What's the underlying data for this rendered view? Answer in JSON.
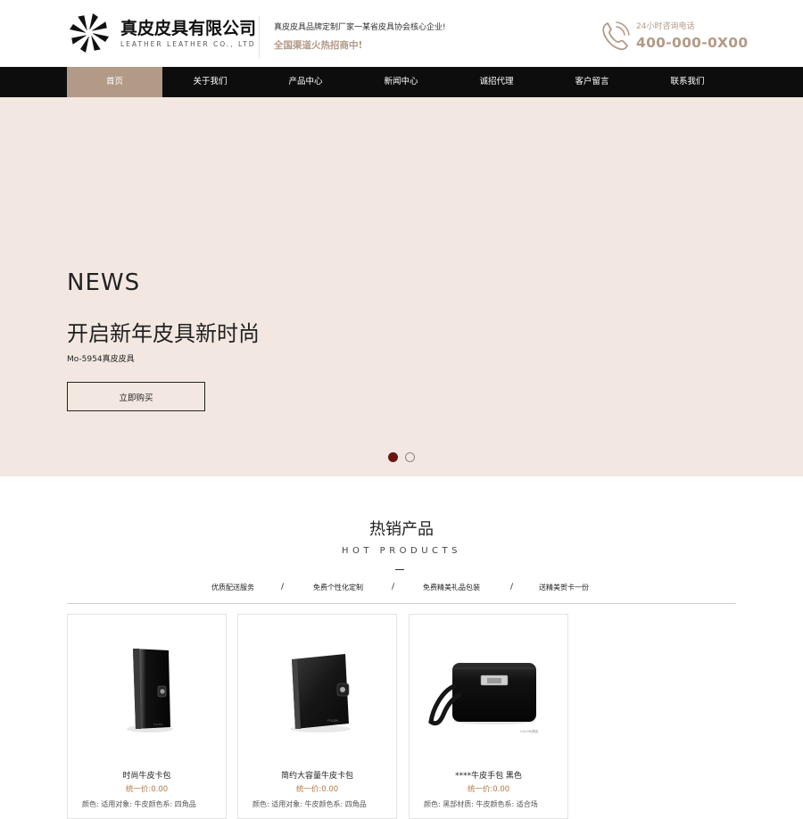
{
  "header": {
    "logo_title": "真皮皮具有限公司",
    "logo_sub": "LEATHER LEATHER CO., LTD",
    "slogan_1": "真皮皮具品牌定制厂家一某省皮具协会核心企业!",
    "slogan_2": "全国渠道火热招商中!",
    "hotline_label": "24小时咨询电话",
    "hotline_number": "400-000-0X00"
  },
  "nav": {
    "items": [
      "首页",
      "关于我们",
      "产品中心",
      "新闻中心",
      "诚招代理",
      "客户留言",
      "联系我们"
    ],
    "active_index": 0
  },
  "banner": {
    "news": "NEWS",
    "title": "开启新年皮具新时尚",
    "subtitle": "Mo-5954真皮皮具",
    "button": "立即购买",
    "slides": 2,
    "active_slide": 0
  },
  "hot": {
    "title": "热销产品",
    "subtitle": "HOT PRODUCTS",
    "features": [
      "优质配送服务",
      "免费个性化定制",
      "免费精美礼品包装",
      "送精美贺卡一份"
    ],
    "separator": "/",
    "products": [
      {
        "name": "时尚牛皮卡包",
        "price": "统一价:0.00",
        "desc": "颜色: 适用对象: 牛皮颜色系: 四角品"
      },
      {
        "name": "简约大容量牛皮卡包",
        "price": "统一价:0.00",
        "desc": "颜色: 适用对象: 牛皮颜色系: 四角品"
      },
      {
        "name": "****牛皮手包 黑色",
        "price": "统一价:0.00",
        "desc": "颜色: 黑部材质: 牛皮颜色系: 适合场"
      }
    ]
  },
  "colors": {
    "accent": "#b39a86",
    "nav_bg": "#0d0d0d",
    "banner_bg": "#f3e8e1",
    "price": "#b27a46",
    "dot_active": "#6b1414"
  }
}
